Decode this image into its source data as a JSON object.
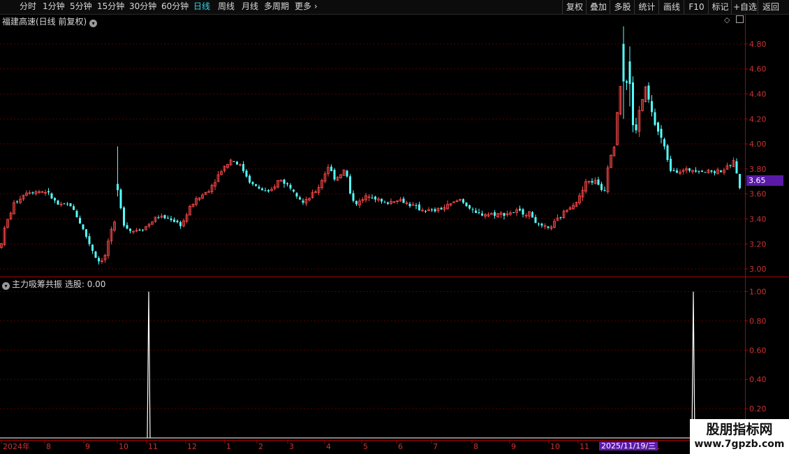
{
  "toolbar": {
    "periods": [
      "分时",
      "1分钟",
      "5分钟",
      "15分钟",
      "30分钟",
      "60分钟",
      "日线",
      "周线",
      "月线",
      "多周期",
      "更多"
    ],
    "active_period": "日线",
    "actions": [
      "复权",
      "叠加",
      "多股",
      "统计",
      "画线",
      "F10",
      "标记",
      "+自选",
      "返回"
    ]
  },
  "main_chart": {
    "title": "福建高速(日线 前复权)",
    "current_price": "3.65",
    "y_ticks": [
      "4.80",
      "4.60",
      "4.40",
      "4.20",
      "4.00",
      "3.80",
      "3.60",
      "3.40",
      "3.20",
      "3.00"
    ],
    "y_values": [
      4.8,
      4.6,
      4.4,
      4.2,
      4.0,
      3.8,
      3.6,
      3.4,
      3.2,
      3.0
    ],
    "colors": {
      "up": "#ff4a4a",
      "down": "#54ffff",
      "grid": "#5a0000",
      "axis": "#b00000"
    }
  },
  "indicator": {
    "title": "主力吸筹共振",
    "xuangu": "选股: 0.00",
    "y_ticks": [
      "1.00",
      "0.80",
      "0.60",
      "0.40",
      "0.20"
    ],
    "y_values": [
      1.0,
      0.8,
      0.6,
      0.4,
      0.2
    ],
    "color": "#ffffff"
  },
  "chart_data": {
    "type": "candlestick",
    "title": "福建高速(日线 前复权)",
    "ylim": [
      2.95,
      4.95
    ],
    "x_ticks": [
      "2024年",
      "8",
      "9",
      "10",
      "11",
      "12",
      "1",
      "2",
      "3",
      "4",
      "5",
      "6",
      "7",
      "8",
      "9",
      "10",
      "11",
      "2025/11/19/三",
      "1"
    ],
    "cursor_date": "2025/11/19/三",
    "price_path": [
      [
        0,
        3.17
      ],
      [
        8,
        3.35
      ],
      [
        20,
        3.52
      ],
      [
        38,
        3.62
      ],
      [
        66,
        3.62
      ],
      [
        85,
        3.5
      ],
      [
        100,
        3.52
      ],
      [
        112,
        3.4
      ],
      [
        130,
        3.18
      ],
      [
        140,
        3.06
      ],
      [
        150,
        3.09
      ],
      [
        156,
        3.25
      ],
      [
        164,
        3.36
      ],
      [
        168,
        3.72
      ],
      [
        175,
        3.38
      ],
      [
        188,
        3.3
      ],
      [
        210,
        3.34
      ],
      [
        225,
        3.42
      ],
      [
        245,
        3.4
      ],
      [
        260,
        3.35
      ],
      [
        275,
        3.52
      ],
      [
        300,
        3.64
      ],
      [
        318,
        3.8
      ],
      [
        332,
        3.88
      ],
      [
        345,
        3.82
      ],
      [
        360,
        3.68
      ],
      [
        385,
        3.6
      ],
      [
        400,
        3.72
      ],
      [
        420,
        3.64
      ],
      [
        435,
        3.52
      ],
      [
        455,
        3.64
      ],
      [
        470,
        3.82
      ],
      [
        480,
        3.72
      ],
      [
        495,
        3.8
      ],
      [
        502,
        3.58
      ],
      [
        512,
        3.52
      ],
      [
        530,
        3.6
      ],
      [
        550,
        3.52
      ],
      [
        570,
        3.56
      ],
      [
        600,
        3.48
      ],
      [
        620,
        3.46
      ],
      [
        640,
        3.5
      ],
      [
        660,
        3.56
      ],
      [
        680,
        3.44
      ],
      [
        720,
        3.44
      ],
      [
        740,
        3.46
      ],
      [
        760,
        3.44
      ],
      [
        772,
        3.34
      ],
      [
        785,
        3.32
      ],
      [
        800,
        3.4
      ],
      [
        815,
        3.5
      ],
      [
        828,
        3.55
      ],
      [
        840,
        3.7
      ],
      [
        855,
        3.7
      ],
      [
        865,
        3.6
      ],
      [
        872,
        3.88
      ],
      [
        880,
        4.0
      ],
      [
        886,
        4.4
      ],
      [
        895,
        4.66
      ],
      [
        902,
        4.18
      ],
      [
        910,
        4.1
      ],
      [
        918,
        4.32
      ],
      [
        925,
        4.44
      ],
      [
        935,
        4.2
      ],
      [
        950,
        4.0
      ],
      [
        960,
        3.8
      ],
      [
        975,
        3.78
      ],
      [
        995,
        3.8
      ],
      [
        1010,
        3.78
      ],
      [
        1025,
        3.78
      ],
      [
        1040,
        3.8
      ],
      [
        1050,
        3.86
      ],
      [
        1056,
        3.76
      ],
      [
        1062,
        3.55
      ]
    ],
    "special_bars": [
      [
        168,
        3.68,
        3.98,
        3.58
      ],
      [
        892,
        4.8,
        4.94,
        4.2
      ],
      [
        898,
        4.66,
        4.78,
        4.3
      ]
    ],
    "bar_spacing": 4.5,
    "indicator_series": {
      "name": "主力吸筹共振",
      "spikes": [
        [
          213,
          1.0
        ],
        [
          993,
          1.0
        ]
      ],
      "baseline": 0.0,
      "ylim": [
        0,
        1.05
      ]
    }
  }
}
